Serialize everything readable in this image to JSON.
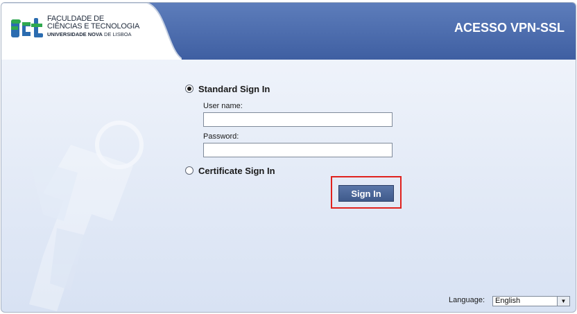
{
  "header": {
    "title": "ACESSO VPN-SSL",
    "logo": {
      "mark": "FCT",
      "line1": "FACULDADE DE",
      "line2": "CIÊNCIAS E TECNOLOGIA",
      "line3_bold": "UNIVERSIDADE NOVA",
      "line3_rest": " DE LISBOA"
    }
  },
  "login": {
    "standard_label": "Standard Sign In",
    "username_label": "User name:",
    "username_value": "",
    "password_label": "Password:",
    "password_value": "",
    "certificate_label": "Certificate Sign In",
    "sign_in_label": "Sign In",
    "selected_method": "standard"
  },
  "footer": {
    "language_label": "Language:",
    "language_selected": "English"
  },
  "colors": {
    "header_blue": "#4566a8",
    "button_blue": "#4a6699",
    "highlight_red": "#e0211d",
    "logo_green": "#2fa84f",
    "logo_blue": "#2b6cb0"
  },
  "icons": [
    "key-watermark-icon",
    "chevron-down-icon",
    "fct-logo"
  ]
}
